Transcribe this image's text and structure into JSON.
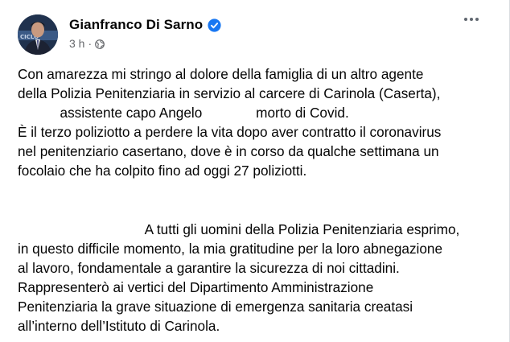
{
  "post": {
    "author": {
      "name": "Gianfranco Di Sarno",
      "verified": true
    },
    "timestamp": "3 h",
    "separator": "·",
    "privacy_icon": "globe-icon",
    "more_icon": "more-options-icon",
    "paragraph_1": "Con amarezza mi stringo al dolore della famiglia di un altro agente\ndella Polizia Penitenziaria in servizio al carcere di Carinola (Caserta),\n           assistente capo Angelo              morto di Covid.\nÈ il terzo poliziotto a perdere la vita dopo aver contratto il coronavirus\nnel penitenziario casertano, dove è in corso da qualche settimana un\nfocolaio che ha colpito fino ad oggi 27 poliziotti.",
    "paragraph_2": "                                 A tutti gli uomini della Polizia Penitenziaria esprimo,\nin questo difficile momento, la mia gratitudine per la loro abnegazione\nal lavoro, fondamentale a garantire la sicurezza di noi cittadini.\nRappresenterò ai vertici del Dipartimento Amministrazione\nPenitenziaria la grave situazione di emergenza sanitaria creatasi\nall’interno dell’Istituto di Carinola."
  },
  "colors": {
    "text": "#050505",
    "secondary_text": "#65676b",
    "verified_badge": "#1877f2"
  }
}
